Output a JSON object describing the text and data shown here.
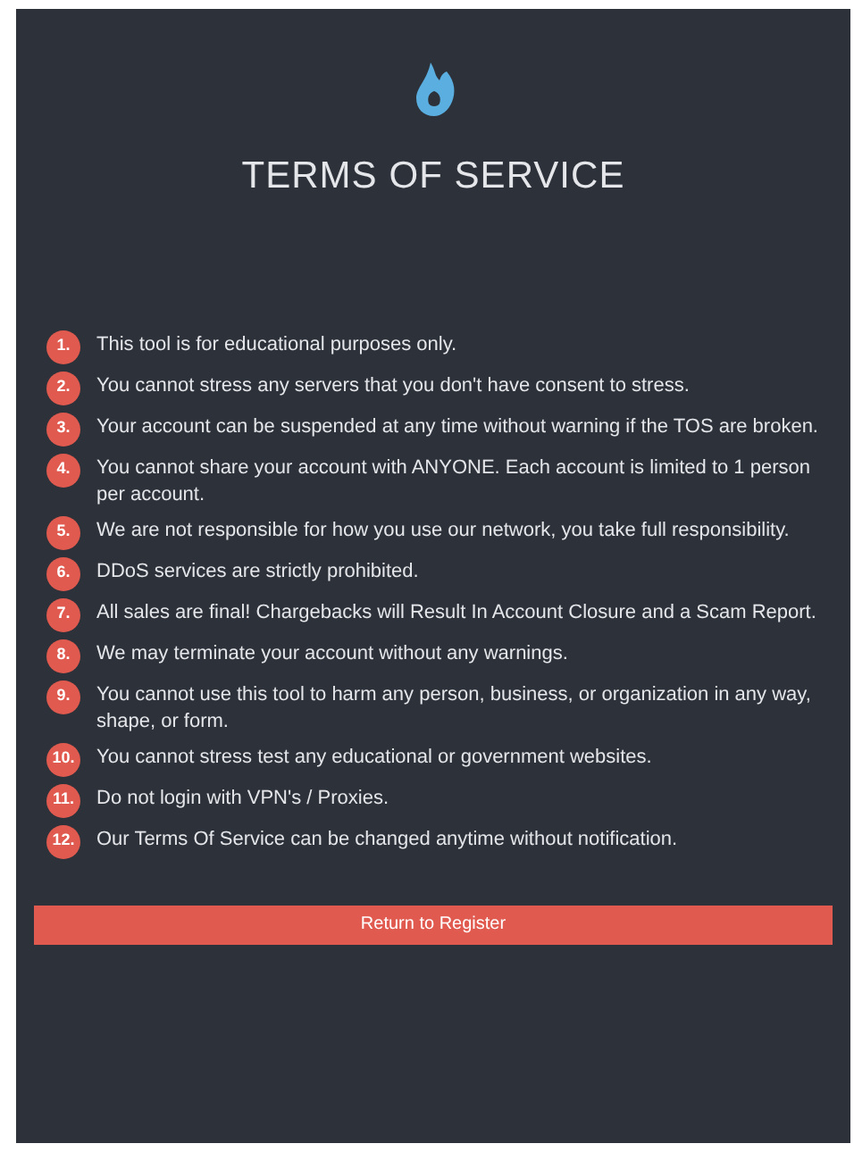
{
  "title": "TERMS OF SERVICE",
  "terms": [
    {
      "number": "1.",
      "text": "This tool is for educational purposes only."
    },
    {
      "number": "2.",
      "text": "You cannot stress any servers that you don't have consent to stress."
    },
    {
      "number": "3.",
      "text": "Your account can be suspended at any time without warning if the TOS are broken."
    },
    {
      "number": "4.",
      "text": "You cannot share your account with ANYONE. Each account is limited to 1 person per account."
    },
    {
      "number": "5.",
      "text": "We are not responsible for how you use our network, you take full responsibility."
    },
    {
      "number": "6.",
      "text": "DDoS services are strictly prohibited."
    },
    {
      "number": "7.",
      "text": "All sales are final! Chargebacks will Result In Account Closure and a Scam Report."
    },
    {
      "number": "8.",
      "text": "We may terminate your account without any warnings."
    },
    {
      "number": "9.",
      "text": "You cannot use this tool to harm any person, business, or organization in any way, shape, or form."
    },
    {
      "number": "10.",
      "text": "You cannot stress test any educational or government websites."
    },
    {
      "number": "11.",
      "text": "Do not login with VPN's / Proxies."
    },
    {
      "number": "12.",
      "text": "Our Terms Of Service can be changed anytime without notification."
    }
  ],
  "button": "Return to Register"
}
